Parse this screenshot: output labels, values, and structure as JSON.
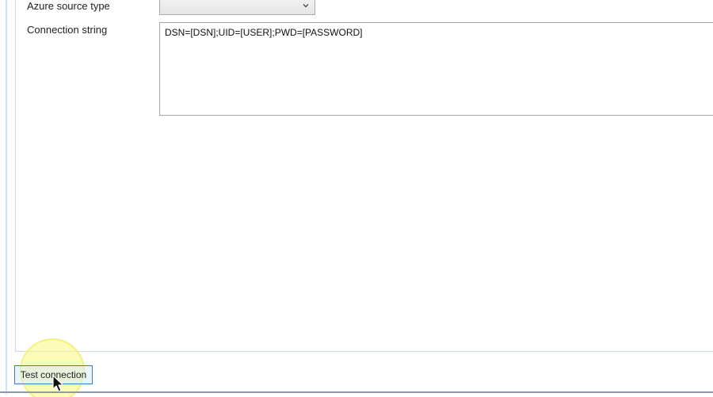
{
  "form": {
    "azure_source_type_label": "Azure source type",
    "azure_source_type_value": "",
    "connection_string_label": "Connection string",
    "connection_string_value": "DSN=[DSN];UID=[USER];PWD=[PASSWORD]"
  },
  "actions": {
    "test_connection_label": "Test connection"
  },
  "icons": {
    "dropdown": "chevron-down-icon",
    "pointer": "mouse-cursor-icon"
  },
  "colors": {
    "button_border": "#3c7fb1",
    "highlight": "#fcf882",
    "panel_border": "#c9d9ea"
  }
}
